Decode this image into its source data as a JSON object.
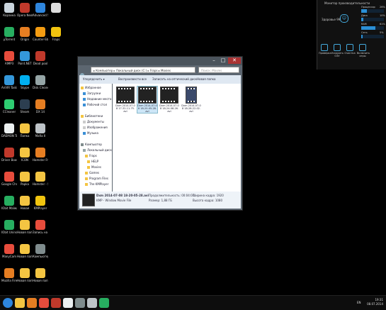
{
  "desktop": {
    "icons": [
      {
        "label": "Корзина",
        "col": 0,
        "row": 0,
        "color": "#c9d4dc"
      },
      {
        "label": "Opera Next",
        "col": 1,
        "row": 0,
        "color": "#c0392b"
      },
      {
        "label": "Advanced SystemCare 7",
        "col": 2,
        "row": 0,
        "color": "#2e86de"
      },
      {
        "label": "",
        "col": 3,
        "row": 0,
        "color": "#dddddd"
      },
      {
        "label": "µTorrent",
        "col": 0,
        "row": 1,
        "color": "#27ae60"
      },
      {
        "label": "Origin",
        "col": 1,
        "row": 1,
        "color": "#e67e22"
      },
      {
        "label": "Counter-Strike Source",
        "col": 2,
        "row": 1,
        "color": "#f39c12"
      },
      {
        "label": "Fraps",
        "col": 3,
        "row": 1,
        "color": "#f1c40f"
      },
      {
        "label": "AIMP3",
        "col": 0,
        "row": 2,
        "color": "#e74c3c"
      },
      {
        "label": "Paint.NET",
        "col": 1,
        "row": 2,
        "color": "#3498db"
      },
      {
        "label": "Dead pool",
        "col": 2,
        "row": 2,
        "color": "#c0392b"
      },
      {
        "label": "AnVIR Task Manager",
        "col": 0,
        "row": 3,
        "color": "#3498db"
      },
      {
        "label": "Skype",
        "col": 1,
        "row": 3,
        "color": "#00aff0"
      },
      {
        "label": "Disk Cleaner",
        "col": 2,
        "row": 3,
        "color": "#95a5a6"
      },
      {
        "label": "CCleaner",
        "col": 0,
        "row": 4,
        "color": "#2ecc71"
      },
      {
        "label": "Steam",
        "col": 1,
        "row": 4,
        "color": "#2c3e50"
      },
      {
        "label": "DX 14",
        "col": 2,
        "row": 4,
        "color": "#e67e22"
      },
      {
        "label": "DAEMON Tools Lite",
        "col": 0,
        "row": 5,
        "color": "#ecf0f1"
      },
      {
        "label": "Папка",
        "col": 1,
        "row": 5,
        "color": "#f4c542"
      },
      {
        "label": "Mafia II",
        "col": 2,
        "row": 5,
        "color": "#bdc3c7"
      },
      {
        "label": "Driver Booster",
        "col": 0,
        "row": 6,
        "color": "#c0392b"
      },
      {
        "label": "ICON",
        "col": 1,
        "row": 6,
        "color": "#f4c542"
      },
      {
        "label": "Hamster Free Video Conv.",
        "col": 2,
        "row": 6,
        "color": "#e67e22"
      },
      {
        "label": "Google Chrome",
        "col": 0,
        "row": 7,
        "color": "#e74c3c"
      },
      {
        "label": "Papka",
        "col": 1,
        "row": 7,
        "color": "#f4c542"
      },
      {
        "label": "Hamster - Ярлык",
        "col": 2,
        "row": 7,
        "color": "#f4c542"
      },
      {
        "label": "IObit Malware",
        "col": 0,
        "row": 8,
        "color": "#27ae60"
      },
      {
        "label": "Новая",
        "col": 1,
        "row": 8,
        "color": "#f4c542"
      },
      {
        "label": "KMPlayer",
        "col": 2,
        "row": 8,
        "color": "#f1c40f"
      },
      {
        "label": "IObit Uninstaller",
        "col": 0,
        "row": 9,
        "color": "#27ae60"
      },
      {
        "label": "Новая папка",
        "col": 1,
        "row": 9,
        "color": "#f4c542"
      },
      {
        "label": "Запись на ...",
        "col": 2,
        "row": 9,
        "color": "#e74c3c"
      },
      {
        "label": "ManyCam",
        "col": 0,
        "row": 10,
        "color": "#e74c3c"
      },
      {
        "label": "Новая папка 2",
        "col": 1,
        "row": 10,
        "color": "#f4c542"
      },
      {
        "label": "Компьютер - Ярлык",
        "col": 2,
        "row": 10,
        "color": "#7f8c8d"
      },
      {
        "label": "Mozilla Firefox",
        "col": 0,
        "row": 11,
        "color": "#e67e22"
      },
      {
        "label": "Новая папка 3",
        "col": 1,
        "row": 11,
        "color": "#f4c542"
      },
      {
        "label": "Новая папка 4",
        "col": 2,
        "row": 11,
        "color": "#f4c542"
      }
    ]
  },
  "explorer": {
    "address": "▸ Компьютер ▸ Локальный диск (C:) ▸ Fraps ▸ Movies",
    "search_placeholder": "Поиск: Movies",
    "toolbar": {
      "organize": "Упорядочить ▾",
      "play": "Воспроизвести все",
      "burn": "Записать на оптический диск",
      "new_folder": "Новая папка"
    },
    "nav": [
      {
        "label": "Избранное",
        "indent": 0,
        "color": "#f4c542"
      },
      {
        "label": "Загрузки",
        "indent": 1,
        "color": "#3a8fd6"
      },
      {
        "label": "Недавние места",
        "indent": 1,
        "color": "#3a8fd6"
      },
      {
        "label": "Рабочий стол",
        "indent": 1,
        "color": "#3a8fd6"
      },
      {
        "label": "",
        "indent": 0,
        "color": "#ffffff"
      },
      {
        "label": "Библиотеки",
        "indent": 0,
        "color": "#f4c542"
      },
      {
        "label": "Документы",
        "indent": 1,
        "color": "#cccccc"
      },
      {
        "label": "Изображения",
        "indent": 1,
        "color": "#cccccc"
      },
      {
        "label": "Музыка",
        "indent": 1,
        "color": "#3a8fd6"
      },
      {
        "label": "",
        "indent": 0,
        "color": "#ffffff"
      },
      {
        "label": "Компьютер",
        "indent": 0,
        "color": "#7f8c8d"
      },
      {
        "label": "Локальный диск",
        "indent": 1,
        "color": "#95a5a6"
      },
      {
        "label": "Fraps",
        "indent": 2,
        "color": "#f4c542"
      },
      {
        "label": "HELP",
        "indent": 3,
        "color": "#f4c542"
      },
      {
        "label": "Movies",
        "indent": 3,
        "color": "#f4c542"
      },
      {
        "label": "Games",
        "indent": 2,
        "color": "#f4c542"
      },
      {
        "label": "Program Files",
        "indent": 2,
        "color": "#f4c542"
      },
      {
        "label": "The KMPlayer",
        "indent": 2,
        "color": "#f4c542"
      }
    ],
    "files": [
      {
        "name": "Dxm 2014-07-08 17-32-11-75.avi",
        "selected": false,
        "thumb": "film"
      },
      {
        "name": "Dxm 2014-07-08 18-20-05-28.avi",
        "selected": true,
        "thumb": "film"
      },
      {
        "name": "Dxm 2014-07-08 18-24-08-26.avi",
        "selected": false,
        "thumb": "film"
      },
      {
        "name": "Dxm 2014-07-08 18-28-22-02.avi",
        "selected": false,
        "thumb": "kmp"
      }
    ],
    "details": {
      "name": "Dxm 2014-07-08 18-20-05-28.avi",
      "type": "KMP - Window Movie File",
      "length_label": "Продолжительность: 00:04:07",
      "size_label": "Размер: 1,88 ГБ",
      "width_label": "Ширина кадра: 1920",
      "height_label": "Высота кадра: 1080"
    }
  },
  "gadget": {
    "title": "Монитор производительности",
    "status": "Здоровье 99",
    "rows": [
      {
        "label": "Процессор",
        "pct": 0.26,
        "value": "26%"
      },
      {
        "label": "Диск",
        "pct": 0.1,
        "value": "10%"
      },
      {
        "label": "RAM",
        "pct": 0.61,
        "value": "61%"
      },
      {
        "label": "Сеть",
        "pct": 0.05,
        "value": "5%"
      }
    ],
    "buttons": [
      "Проверка",
      "Ускорить ОЗУ",
      "Очистка",
      "Включить игры"
    ]
  },
  "taskbar": {
    "lang": "EN",
    "time": "19:31",
    "date": "08.07.2014",
    "items": [
      {
        "name": "start-button",
        "color": "#2e86de"
      },
      {
        "name": "explorer-pinned",
        "color": "#f4c542"
      },
      {
        "name": "media-player",
        "color": "#e67e22"
      },
      {
        "name": "chrome-pinned",
        "color": "#e74c3c"
      },
      {
        "name": "opera-pinned",
        "color": "#c0392b"
      },
      {
        "name": "steam-pinned",
        "color": "#ecf0f1"
      },
      {
        "name": "window-explorer",
        "color": "#7f8c8d"
      },
      {
        "name": "app-1",
        "color": "#bdc3c7"
      },
      {
        "name": "app-2",
        "color": "#27ae60"
      }
    ]
  }
}
